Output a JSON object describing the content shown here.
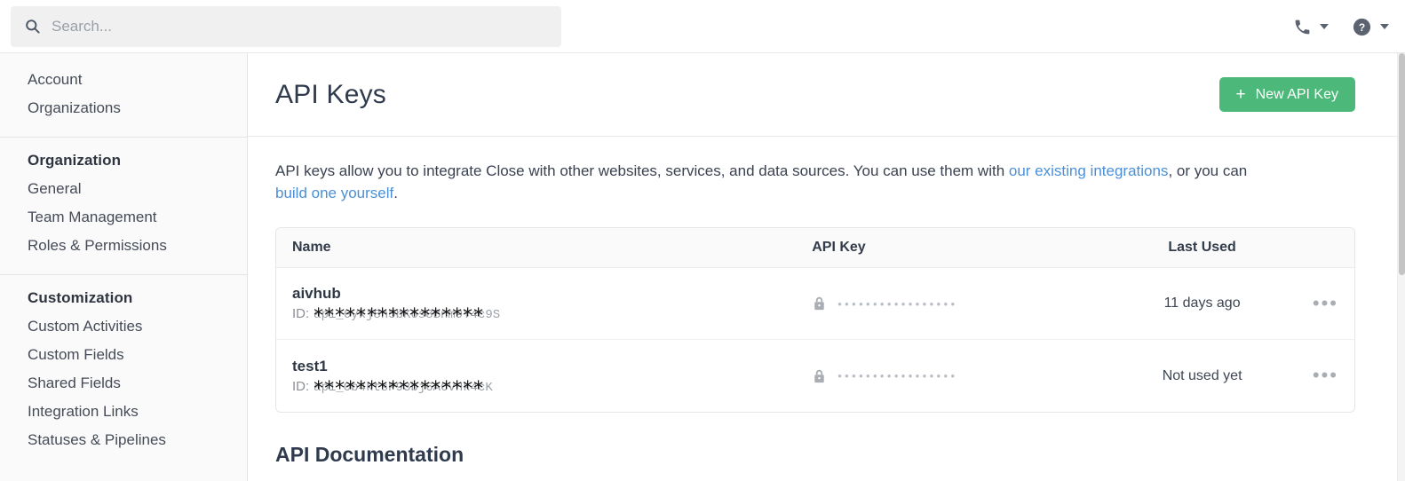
{
  "topbar": {
    "search": {
      "placeholder": "Search...",
      "value": "",
      "icon": "search-icon"
    },
    "phone": {
      "icon": "phone-icon",
      "caret": "chevron-down-icon"
    },
    "help": {
      "icon": "help-circle-icon",
      "caret": "chevron-down-icon"
    }
  },
  "sidebar": {
    "groups": [
      {
        "heading": "",
        "items": [
          {
            "label": "Account"
          },
          {
            "label": "Organizations"
          }
        ]
      },
      {
        "heading": "Organization",
        "items": [
          {
            "label": "General"
          },
          {
            "label": "Team Management"
          },
          {
            "label": "Roles & Permissions"
          }
        ]
      },
      {
        "heading": "Customization",
        "items": [
          {
            "label": "Custom Activities"
          },
          {
            "label": "Custom Fields"
          },
          {
            "label": "Shared Fields"
          },
          {
            "label": "Integration Links"
          },
          {
            "label": "Statuses & Pipelines"
          }
        ]
      }
    ]
  },
  "main": {
    "title": "API Keys",
    "new_key_button": {
      "label": "New API Key",
      "plus": "+",
      "color": "#4cb87a"
    },
    "intro": {
      "part1": "API keys allow you to integrate Close with other websites, services, and data sources. You can use them with ",
      "link1": "our existing integrations",
      "part2": ", or you can ",
      "link2": "build one yourself",
      "part3": ".",
      "link_color": "#4a90d9"
    },
    "table": {
      "columns": [
        "Name",
        "API Key",
        "Last Used"
      ],
      "rows": [
        {
          "name": "aivhub",
          "id_label": "ID:",
          "id_value": "****************",
          "api_key_masked": "•••••••••••••••••",
          "lock_icon": "lock-icon",
          "last_used": "11 days ago",
          "menu_icon": "ellipsis-icon"
        },
        {
          "name": "test1",
          "id_label": "ID:",
          "id_value": "****************",
          "api_key_masked": "•••••••••••••••••",
          "lock_icon": "lock-icon",
          "last_used": "Not used yet",
          "menu_icon": "ellipsis-icon"
        }
      ]
    },
    "doc_heading": "API Documentation"
  }
}
